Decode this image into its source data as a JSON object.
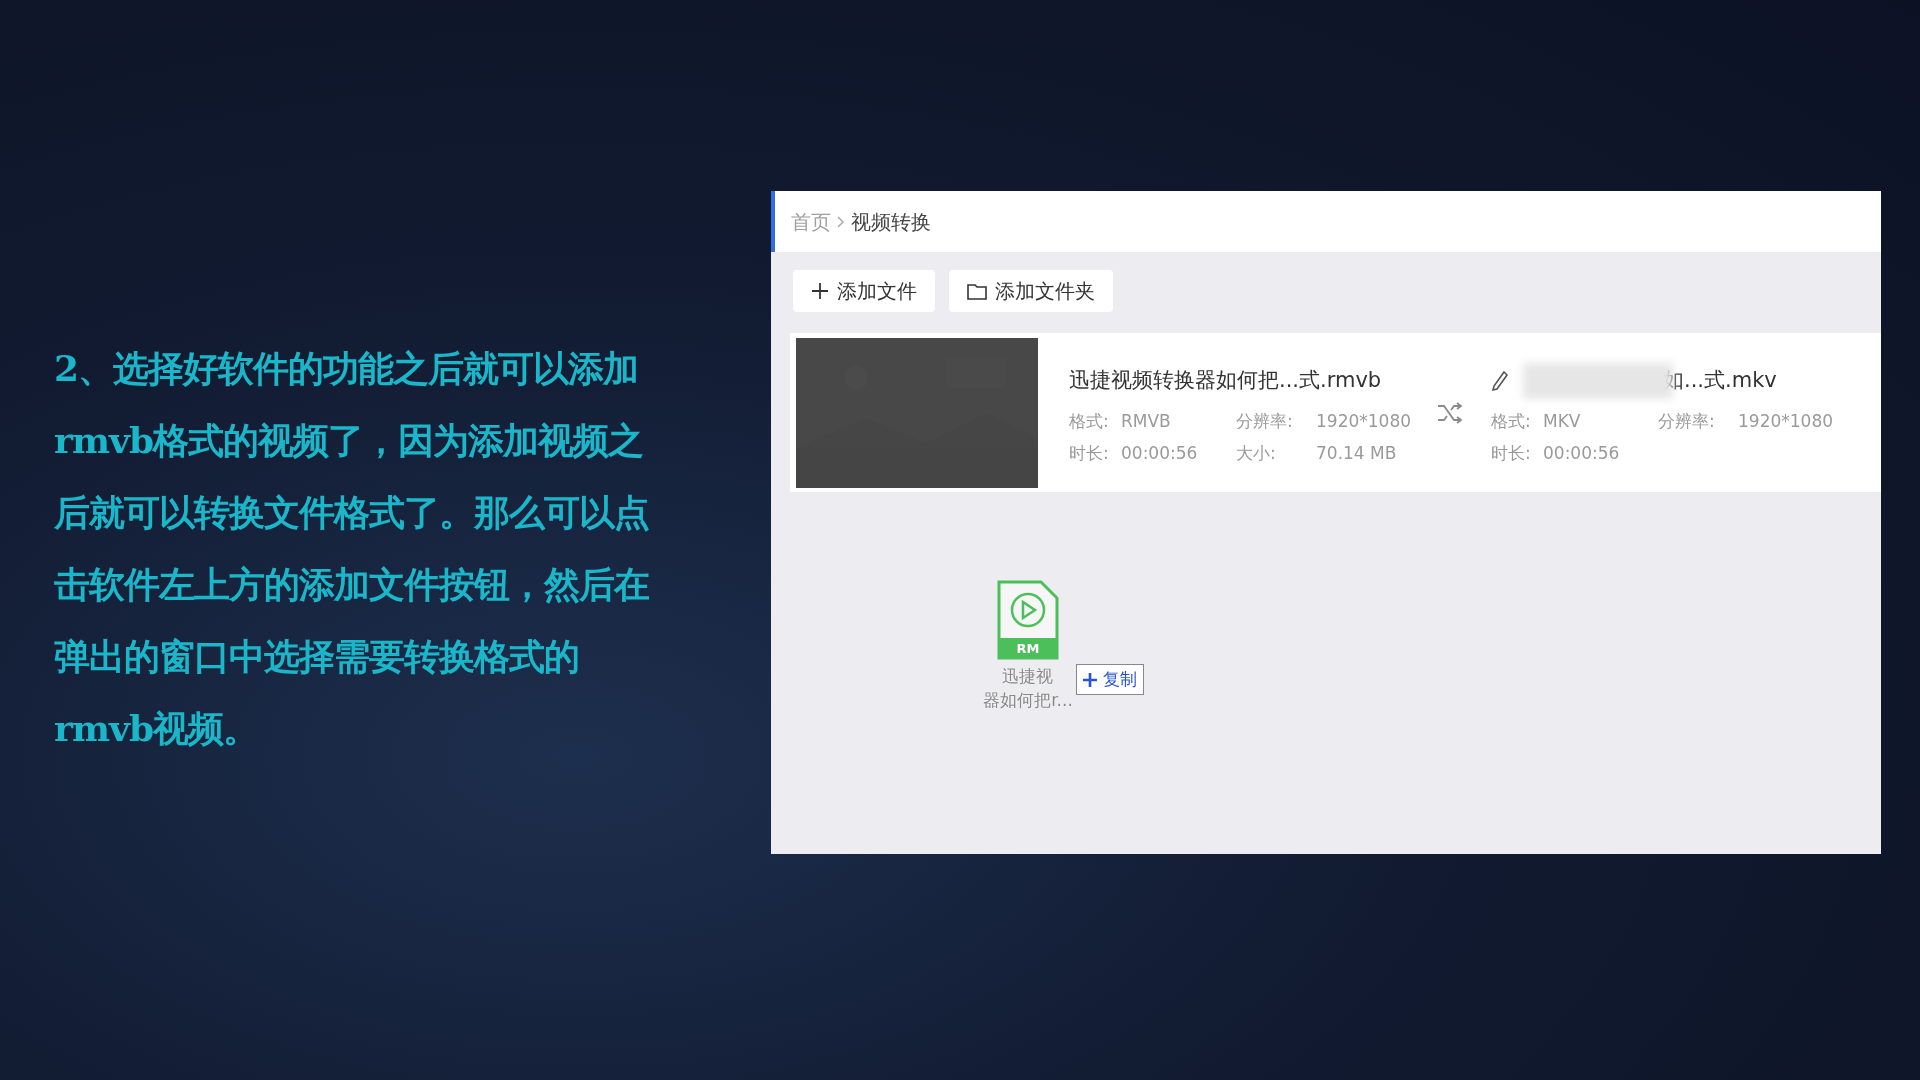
{
  "slide_text": {
    "lines": [
      "2、选择好软件的功能之后就可以添加",
      "rmvb格式的视频了，因为添加视频之",
      "后就可以转换文件格式了。那么可以点",
      "击软件左上方的添加文件按钮，然后在",
      "弹出的窗口中选择需要转换格式的",
      "rmvb视频。"
    ]
  },
  "app": {
    "breadcrumb": [
      {
        "label": "首页",
        "selected": false
      },
      {
        "label": "视频转换",
        "selected": true
      }
    ],
    "toolbar": [
      {
        "kind": "add-file",
        "label": "添加文件"
      },
      {
        "kind": "add-folder",
        "label": "添加文件夹"
      }
    ],
    "file": {
      "source_name": "迅捷视频转换器如何把...式.rmvb",
      "source_meta": [
        [
          "格式:",
          "RMVB",
          "分辨率:",
          "1920*1080"
        ],
        [
          "时长:",
          "00:00:56",
          "大小:",
          "70.14 MB"
        ]
      ],
      "output_name": "如...式.mkv",
      "output_meta": [
        [
          "格式:",
          "MKV",
          "分辨率:",
          "1920*1080"
        ],
        [
          "时长:",
          "00:00:56"
        ]
      ]
    },
    "dragged": {
      "badge": "RM",
      "label_lines": [
        "迅捷视",
        "器如何把r..."
      ],
      "tag": "复制"
    }
  }
}
